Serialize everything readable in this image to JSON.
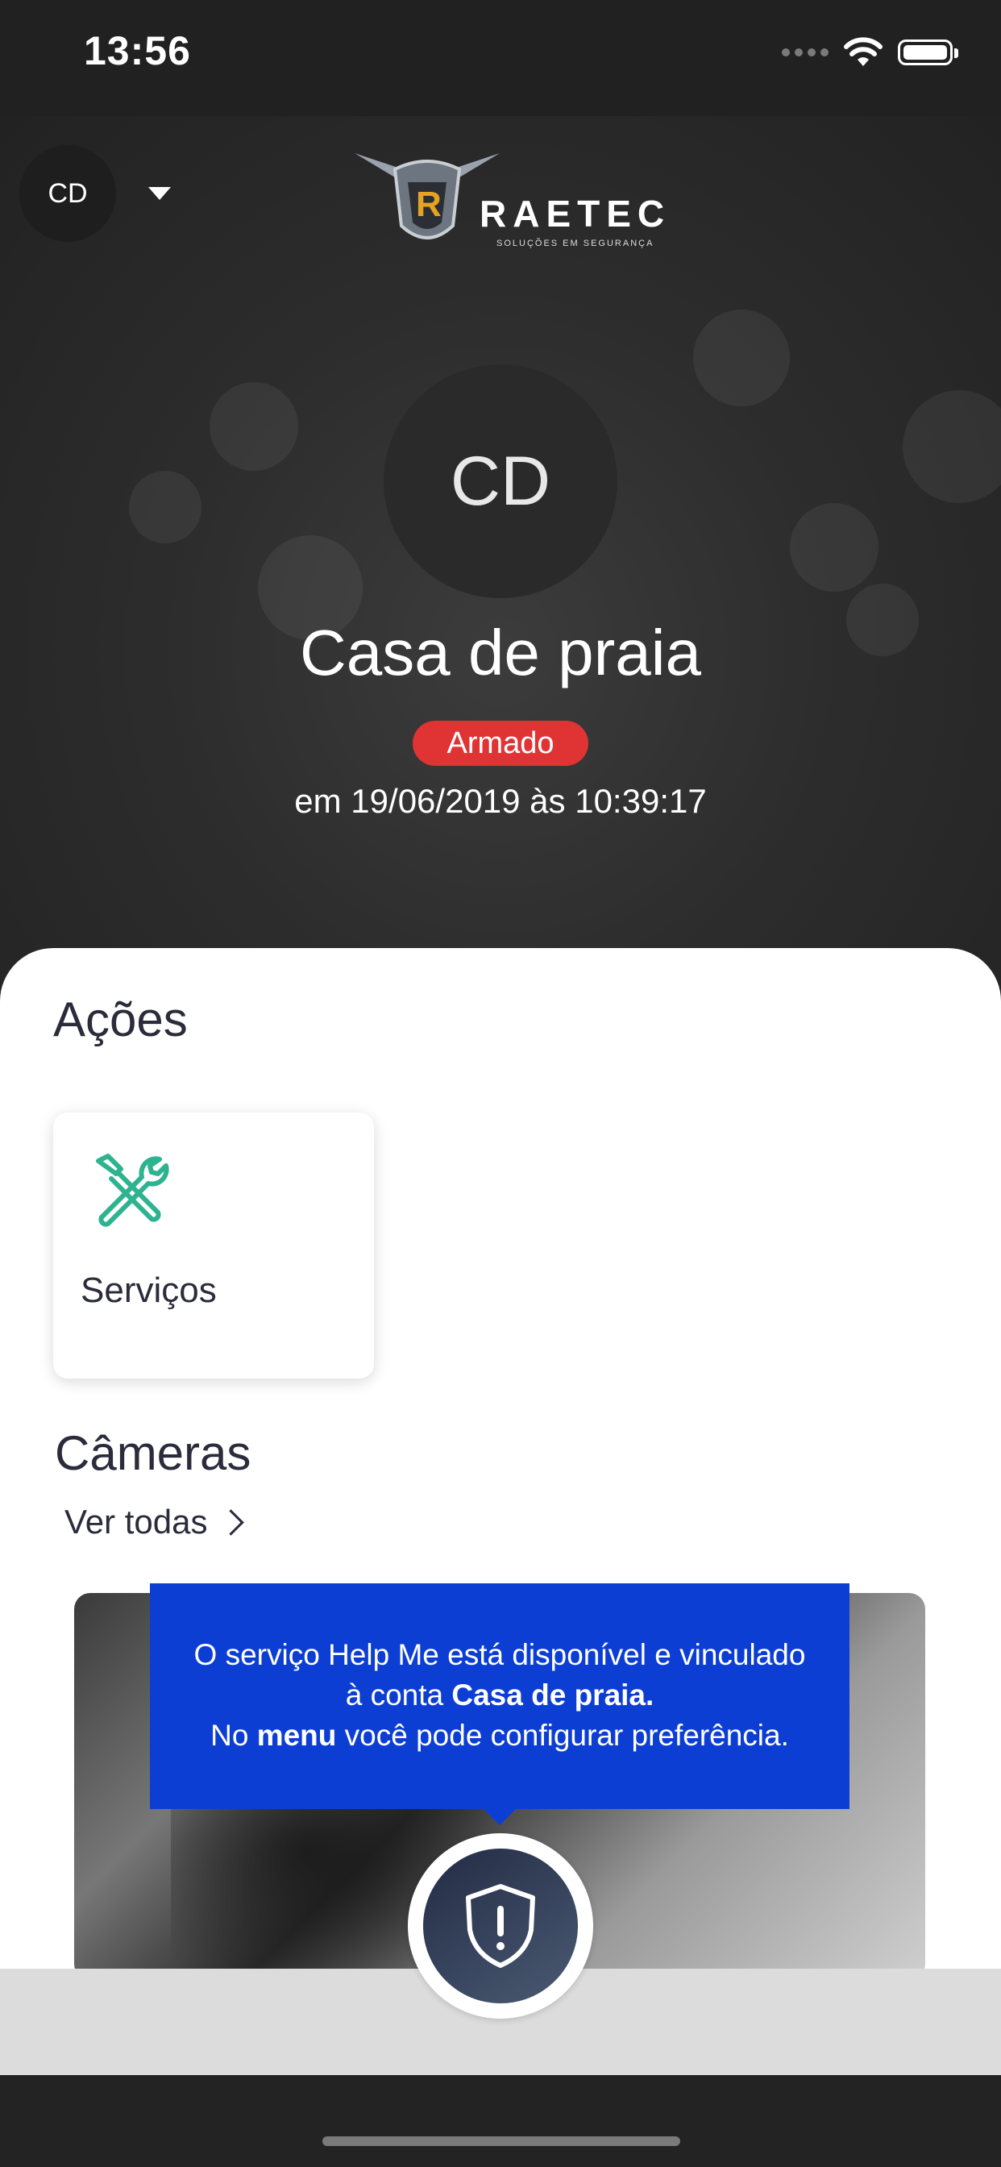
{
  "status_bar": {
    "time": "13:56"
  },
  "header": {
    "account_initials": "CD",
    "logo_text": "RAETEC",
    "logo_sub": "SOLUÇÕES EM SEGURANÇA",
    "avatar_initials": "CD",
    "place_name": "Casa de praia",
    "status_badge": "Armado",
    "status_time": "em 19/06/2019 às 10:39:17",
    "status_color": "#e03434"
  },
  "actions": {
    "title": "Ações",
    "items": [
      {
        "label": "Serviços",
        "icon": "tools-icon",
        "color": "#2db38f"
      }
    ]
  },
  "cameras": {
    "title": "Câmeras",
    "see_all": "Ver todas"
  },
  "tooltip": {
    "line1": "O serviço Help Me está disponível e vinculado",
    "line2_prefix": "à conta ",
    "line2_bold": "Casa de praia.",
    "line3_prefix": "No ",
    "line3_bold": "menu",
    "line3_suffix": " você pode configurar preferência.",
    "bg_color": "#0d3ed4"
  },
  "help_button": {
    "icon": "shield-alert-icon"
  }
}
